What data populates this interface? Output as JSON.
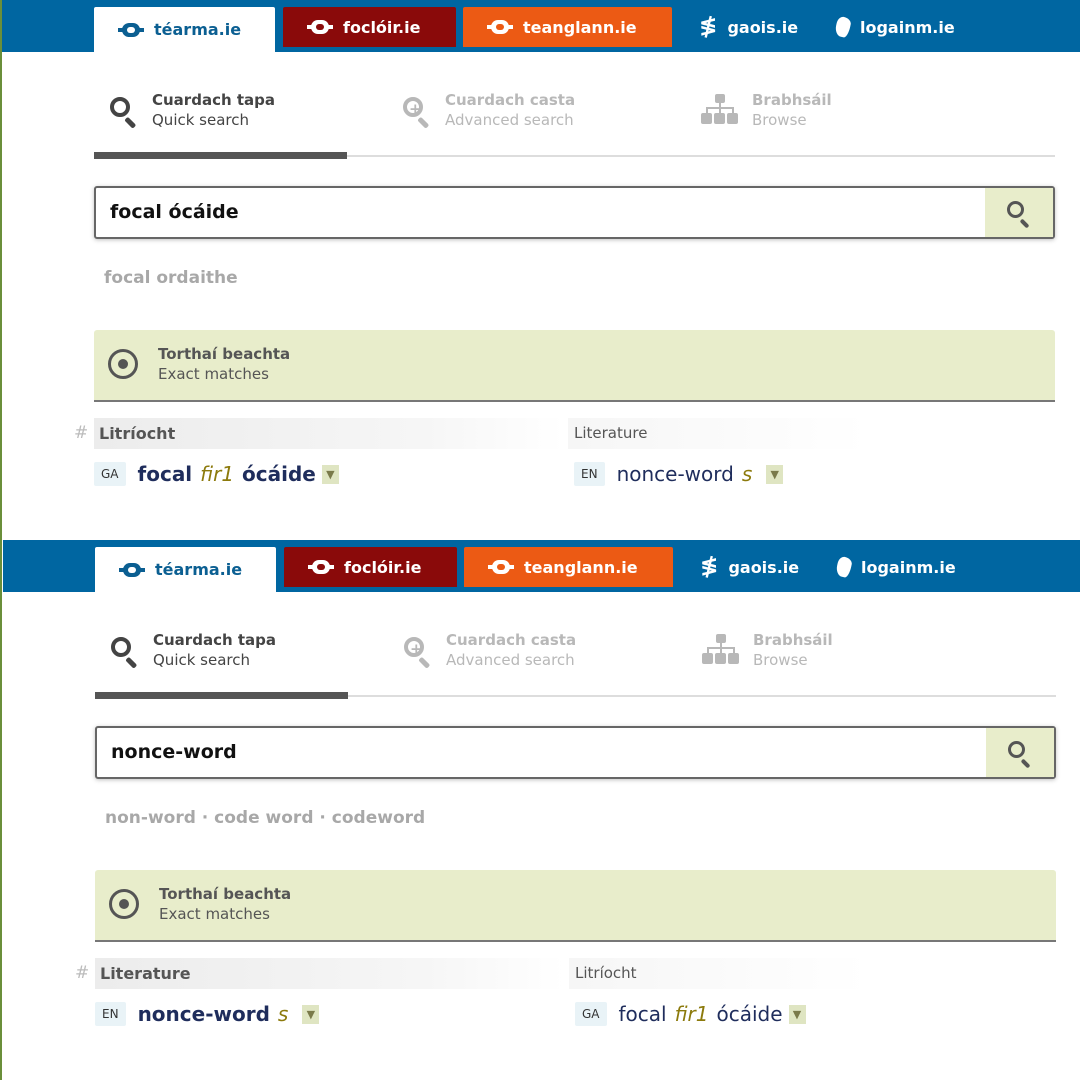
{
  "colors": {
    "brand_blue": "#0066a1",
    "focloir_red": "#8a0a0a",
    "teanglann_orange": "#ec5a14",
    "accent_green_bg": "#e8edcb"
  },
  "sites": {
    "tearma": "téarma.ie",
    "focloir": "foclóir.ie",
    "teanglann": "teanglann.ie",
    "gaois": "gaois.ie",
    "logainm": "logainm.ie"
  },
  "modes": {
    "quick": {
      "ga": "Cuardach tapa",
      "en": "Quick search",
      "icon": "search-icon"
    },
    "advanced": {
      "ga": "Cuardach casta",
      "en": "Advanced search",
      "icon": "zoom-in-icon"
    },
    "browse": {
      "ga": "Brabhsáil",
      "en": "Browse",
      "icon": "hierarchy-icon"
    }
  },
  "exact_header": {
    "ga": "Torthaí beachta",
    "en": "Exact matches"
  },
  "panels": [
    {
      "query": "focal ócáide",
      "suggestions": "focal ordaithe",
      "domain_left": "Litríocht",
      "domain_right": "Literature",
      "left_term": {
        "lang": "GA",
        "head": "focal",
        "pos": "fir1",
        "tail": "ócáide"
      },
      "right_term": {
        "lang": "EN",
        "head": "nonce-word",
        "pos": "s"
      }
    },
    {
      "query": "nonce-word",
      "suggestions": "non-word · code word · codeword",
      "domain_left": "Literature",
      "domain_right": "Litríocht",
      "left_term": {
        "lang": "EN",
        "head": "nonce-word",
        "pos": "s"
      },
      "right_term": {
        "lang": "GA",
        "head": "focal",
        "pos": "fir1",
        "tail": "ócáide"
      }
    }
  ]
}
